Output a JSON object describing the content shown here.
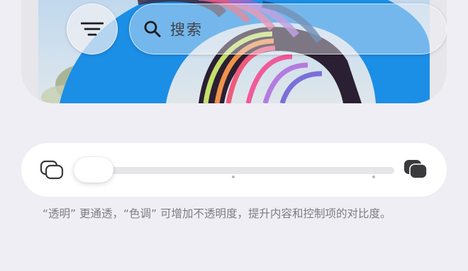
{
  "search": {
    "placeholder": "搜索"
  },
  "icons": {
    "filter": "filter-lines-icon",
    "search": "magnifier-icon",
    "transparent_end": "transparent-layers-icon",
    "tinted_end": "tinted-layers-icon"
  },
  "appearance_slider": {
    "value": 0,
    "min_label": "透明",
    "max_label": "色调",
    "ticks": [
      0.5,
      1.0
    ]
  },
  "footnote": "“透明” 更通透，“色调” 可增加不透明度，提升内容和控制项的对比度。",
  "colors": {
    "page_background": "#efeef4",
    "card_background": "#ffffff",
    "track": "#e5e5ea",
    "footnote_text": "#7c7c82",
    "sky_blue": "#1d8fe8"
  }
}
